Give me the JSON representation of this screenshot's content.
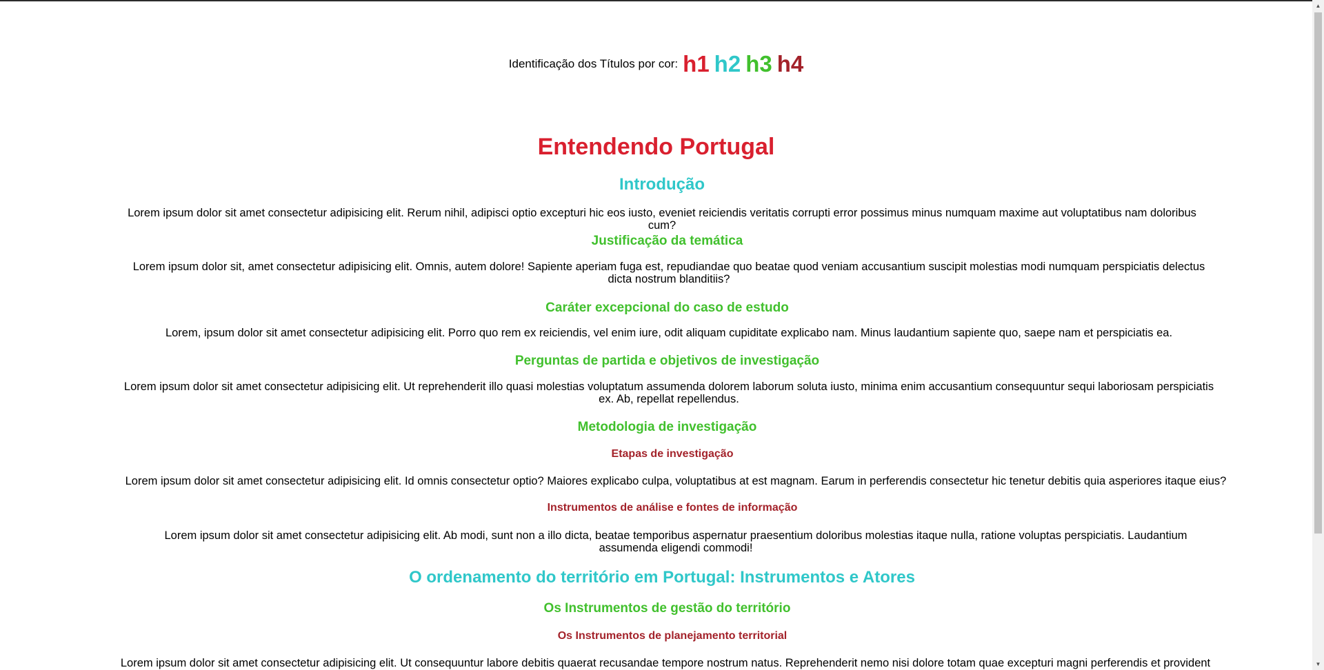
{
  "legend": {
    "label": "Identificação dos Títulos por cor:",
    "h1": "h1",
    "h2": "h2",
    "h3": "h3",
    "h4": "h4"
  },
  "doc": {
    "title": "Entendendo Portugal",
    "intro_heading": "Introdução",
    "intro_text": "Lorem ipsum dolor sit amet consectetur adipisicing elit. Rerum nihil, adipisci optio excepturi hic eos iusto, eveniet reiciendis veritatis corrupti error possimus minus numquam maxime aut voluptatibus nam doloribus cum?",
    "just_heading": "Justificação da temática",
    "just_text": "Lorem ipsum dolor sit, amet consectetur adipisicing elit. Omnis, autem dolore! Sapiente aperiam fuga est, repudiandae quo beatae quod veniam accusantium suscipit molestias modi numquam perspiciatis delectus dicta nostrum blanditiis?",
    "carater_heading": "Caráter excepcional do caso de estudo",
    "carater_text": "Lorem, ipsum dolor sit amet consectetur adipisicing elit. Porro quo rem ex reiciendis, vel enim iure, odit aliquam cupiditate explicabo nam. Minus laudantium sapiente quo, saepe nam et perspiciatis ea.",
    "perguntas_heading": "Perguntas de partida e objetivos de investigação",
    "perguntas_text": "Lorem ipsum dolor sit amet consectetur adipisicing elit. Ut reprehenderit illo quasi molestias voluptatum assumenda dolorem laborum soluta iusto, minima enim accusantium consequuntur sequi laboriosam perspiciatis ex. Ab, repellat repellendus.",
    "metodologia_heading": "Metodologia de investigação",
    "etapas_heading": "Etapas de investigação",
    "etapas_text": "Lorem ipsum dolor sit amet consectetur adipisicing elit. Id omnis consectetur optio? Maiores explicabo culpa, voluptatibus at est magnam. Earum in perferendis consectetur hic tenetur debitis quia asperiores itaque eius?",
    "instrumentos_heading": "Instrumentos de análise e fontes de informação",
    "instrumentos_text": "Lorem ipsum dolor sit amet consectetur adipisicing elit. Ab modi, sunt non a illo dicta, beatae temporibus aspernatur praesentium doloribus molestias itaque nulla, ratione voluptas perspiciatis. Laudantium assumenda eligendi commodi!",
    "ordenamento_heading": "O ordenamento do território em Portugal: Instrumentos e Atores",
    "gestao_heading": "Os Instrumentos de gestão do território",
    "planejamento_heading": "Os Instrumentos de planejamento territorial",
    "planejamento_text": "Lorem ipsum dolor sit amet consectetur adipisicing elit. Ut consequuntur labore debitis quaerat recusandae tempore nostrum natus. Reprehenderit nemo nisi dolore totam quae excepturi magni perferendis et provident"
  }
}
